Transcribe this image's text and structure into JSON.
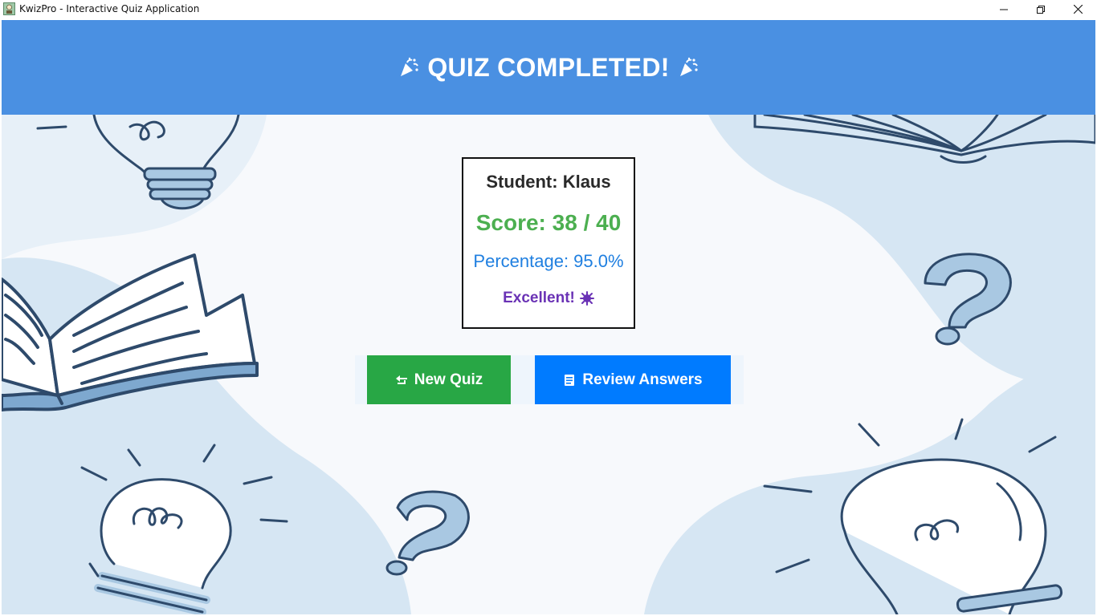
{
  "window": {
    "title": "KwizPro - Interactive Quiz Application",
    "controls": {
      "minimize": "minimize-icon",
      "maximize": "restore-icon",
      "close": "close-icon"
    }
  },
  "header": {
    "title": "QUIZ COMPLETED!",
    "left_icon": "party-popper-icon",
    "right_icon": "party-popper-icon",
    "background": "#4a90e2"
  },
  "result": {
    "student": "Student: Klaus",
    "score": "Score: 38 / 40",
    "percentage": "Percentage: 95.0%",
    "feedback": "Excellent!",
    "feedback_icon": "sparkle-icon"
  },
  "actions": {
    "new_quiz": {
      "label": "New Quiz",
      "icon": "back-arrow-icon",
      "color": "#28a745"
    },
    "review_answers": {
      "label": "Review Answers",
      "icon": "notepad-icon",
      "color": "#007bff"
    }
  },
  "colors": {
    "score": "#4caf50",
    "percentage": "#1f7fe0",
    "feedback": "#6a32b5"
  }
}
